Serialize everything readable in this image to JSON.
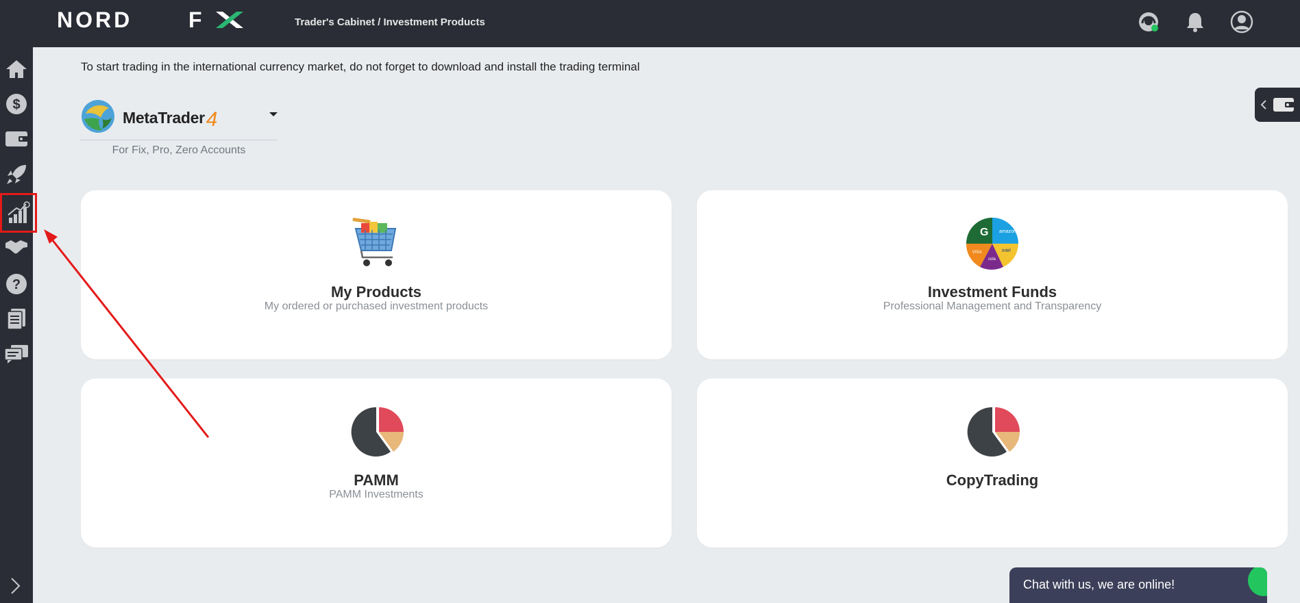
{
  "header": {
    "logo_text": "NORD FX",
    "breadcrumb": "Trader's Cabinet / Investment Products"
  },
  "sidebar": {
    "items": [
      {
        "name": "home-icon"
      },
      {
        "name": "dollar-icon"
      },
      {
        "name": "wallet-icon"
      },
      {
        "name": "rocket-icon"
      },
      {
        "name": "investment-chart-icon",
        "highlighted": true
      },
      {
        "name": "handshake-icon"
      },
      {
        "name": "help-icon"
      },
      {
        "name": "documents-icon"
      },
      {
        "name": "chat-icon"
      }
    ],
    "expand_icon": "chevron-right-icon"
  },
  "main": {
    "notice": "To start trading in the international currency market, do not forget to download and install the trading terminal",
    "terminal": {
      "name": "MetaTrader",
      "version": "4",
      "subtitle": "For Fix, Pro, Zero Accounts"
    },
    "cards": [
      {
        "title": "My Products",
        "subtitle": "My ordered or purchased investment products",
        "icon": "shopping-cart-icon"
      },
      {
        "title": "Investment Funds",
        "subtitle": "Professional Management and Transparency",
        "icon": "fund-pie-icon"
      },
      {
        "title": "PAMM",
        "subtitle": "PAMM Investments",
        "icon": "pie-chart-icon"
      },
      {
        "title": "CopyTrading",
        "subtitle": "",
        "icon": "pie-chart-icon"
      }
    ]
  },
  "chat": {
    "label": "Chat with us, we are online!"
  },
  "colors": {
    "topbar": "#2a2d35",
    "background": "#e9ecef",
    "highlight": "#e31a1a",
    "pie_red": "#e04a5a",
    "pie_dark": "#3d4246",
    "pie_tan": "#e8b77a"
  }
}
